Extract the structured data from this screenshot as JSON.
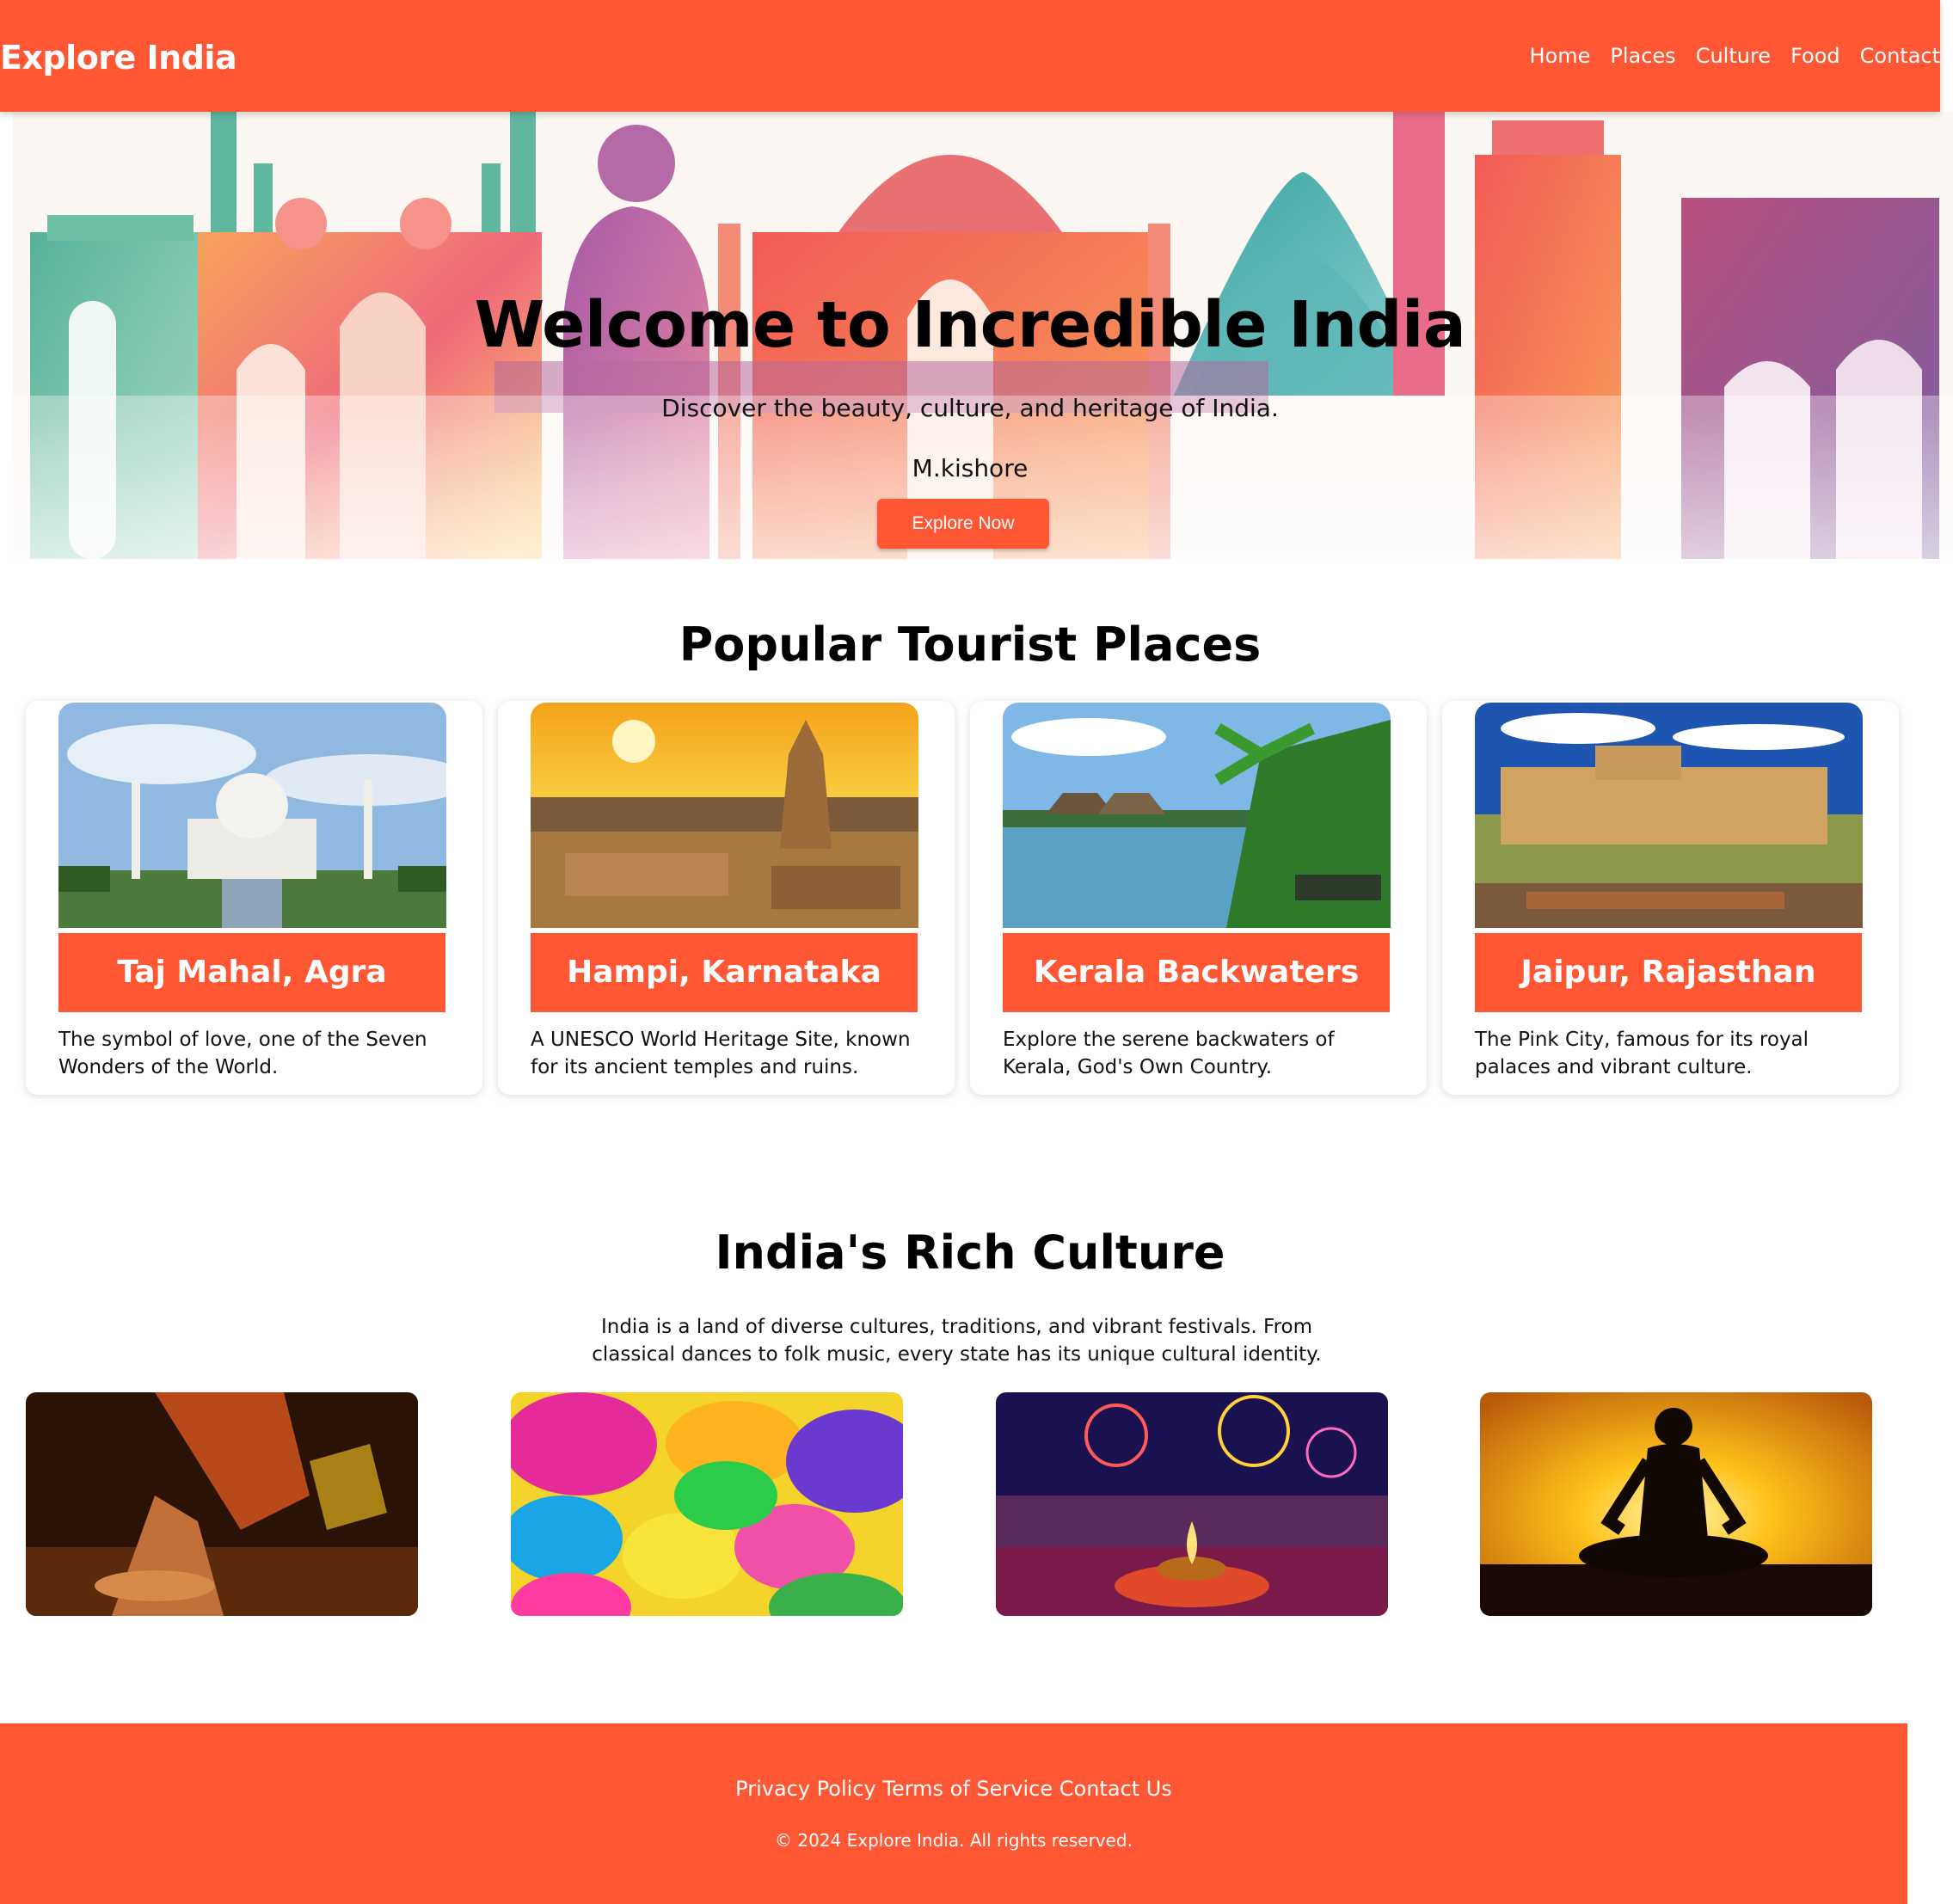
{
  "nav": {
    "brand": "Explore India",
    "links": [
      "Home",
      "Places",
      "Culture",
      "Food",
      "Contact"
    ]
  },
  "hero": {
    "title": "Welcome to Incredible India",
    "subtitle": "Discover the beauty, culture, and heritage of India.",
    "author": "M.kishore",
    "button_label": "Explore Now"
  },
  "places": {
    "title": "Popular Tourist Places",
    "cards": [
      {
        "name": "Taj Mahal, Agra",
        "description": "The symbol of love, one of the Seven Wonders of the World.",
        "image": "taj-mahal-photo"
      },
      {
        "name": "Hampi, Karnataka",
        "description": "A UNESCO World Heritage Site, known for its ancient temples and ruins.",
        "image": "hampi-temple-photo"
      },
      {
        "name": "Kerala Backwaters",
        "description": "Explore the serene backwaters of Kerala, God's Own Country.",
        "image": "kerala-backwaters-photo"
      },
      {
        "name": "Jaipur, Rajasthan",
        "description": "The Pink City, famous for its royal palaces and vibrant culture.",
        "image": "jaipur-fort-photo"
      }
    ]
  },
  "culture": {
    "title": "India's Rich Culture",
    "description": "India is a land of diverse cultures, traditions, and vibrant festivals. From classical dances to folk music, every state has its unique cultural identity.",
    "images": [
      "classical-dance-photo",
      "holi-colors-photo",
      "diwali-festival-photo",
      "yoga-silhouette-photo"
    ]
  },
  "footer": {
    "links": [
      "Privacy Policy",
      "Terms of Service",
      "Contact Us"
    ],
    "copyright": "© 2024 Explore India. All rights reserved."
  },
  "colors": {
    "accent": "#ff5733",
    "text": "#111111",
    "background": "#ffffff"
  }
}
